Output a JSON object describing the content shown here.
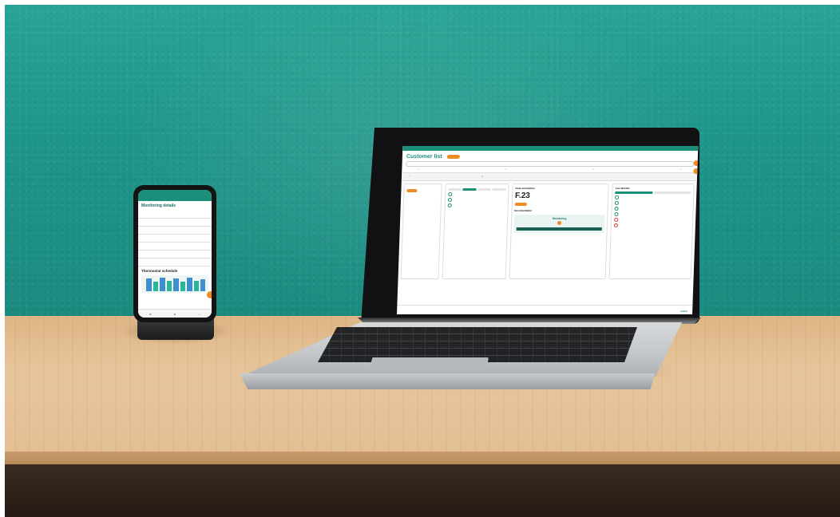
{
  "phone": {
    "appbar": "",
    "title": "Monitoring details",
    "subtitle": "",
    "rows": [
      {
        "label": "",
        "value": ""
      },
      {
        "label": "",
        "value": ""
      },
      {
        "label": "",
        "value": ""
      },
      {
        "label": "",
        "value": ""
      },
      {
        "label": "",
        "value": ""
      },
      {
        "label": "",
        "value": ""
      },
      {
        "label": "",
        "value": ""
      }
    ],
    "section_title": "Thermostat schedule",
    "legend": ""
  },
  "laptop": {
    "app_title": "Customer list",
    "code_description_title": "Code description",
    "fault_code": "F.23",
    "live_monitor_title": "Live Monitor",
    "documentation_label": "Documentation",
    "monitoring_label": "Monitoring",
    "brand": "Vaillant"
  },
  "colors": {
    "wall": "#1f968a",
    "desk": "#e3bf94",
    "brand_teal": "#1b8f7a",
    "accent_orange": "#f08a24"
  },
  "icons": [
    "phone-device",
    "laptop-device",
    "brand-logo-icon"
  ]
}
